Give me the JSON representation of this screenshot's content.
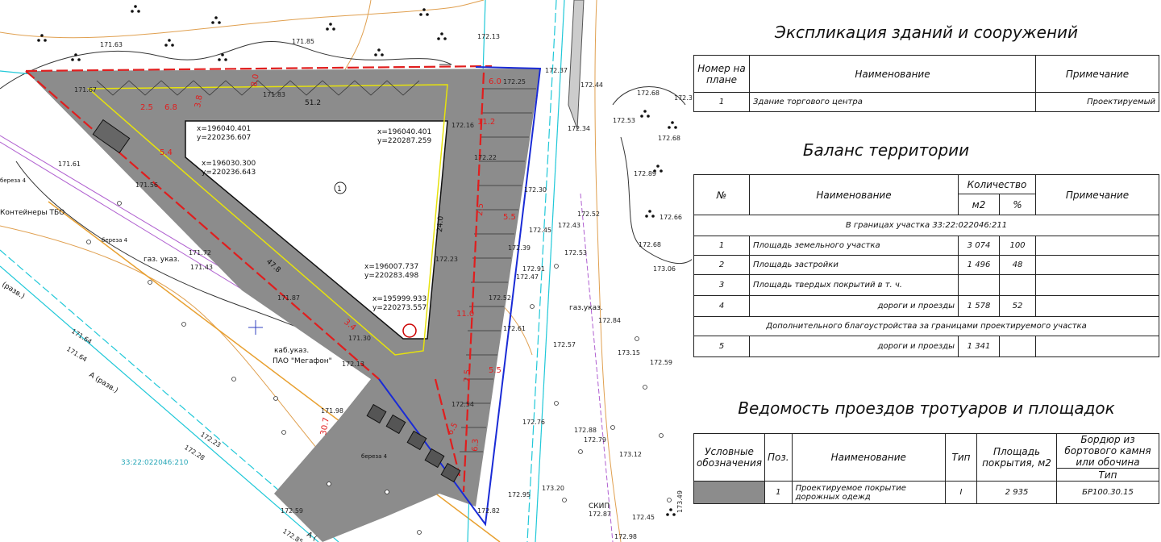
{
  "plan": {
    "labels": {
      "building_no": "1",
      "container": "Контейнеры ТБО",
      "megafon": "ПАО \"Мегафон\"",
      "kab": "каб.указ.",
      "gaz1": "газ. указ.",
      "gaz2": "газ.указ.",
      "skip": "СКИП",
      "parcel": "33:22:022046:210",
      "road1": "А (разв.)",
      "road2": "(разв.)",
      "road3": "А (",
      "bereza1": "береза 4",
      "bereza2": "береза 4",
      "bereza3": "береза 4"
    },
    "coords": [
      {
        "x": "x=196040.401",
        "y": "y=220236.607"
      },
      {
        "x": "x=196040.401",
        "y": "y=220287.259"
      },
      {
        "x": "x=196030.300",
        "y": "y=220236.643"
      },
      {
        "x": "x=196007.737",
        "y": "y=220283.498"
      },
      {
        "x": "x=195999.933",
        "y": "y=220273.557"
      }
    ],
    "dims": [
      "51.2",
      "47.8",
      "24.0",
      "11.2",
      "11.0",
      "30.7",
      "6.0",
      "5.5",
      "5.5",
      "2.5",
      "2.5",
      "6.5",
      "6.3",
      "3.8",
      "8.0",
      "2.5",
      "6.8",
      "5.4",
      "3.4"
    ],
    "elevations": [
      "171.63",
      "171.85",
      "171.67",
      "171.83",
      "171.61",
      "171.56",
      "171.72",
      "171.43",
      "171.87",
      "171.64",
      "171.64",
      "171.30",
      "172.13",
      "171.98",
      "172.23",
      "172.28",
      "172.59",
      "172.85",
      "172.13",
      "172.37",
      "172.25",
      "172.16",
      "172.22",
      "172.30",
      "172.39",
      "172.23",
      "172.45",
      "172.43",
      "172.47",
      "172.52",
      "172.61",
      "172.54",
      "172.91",
      "172.52",
      "172.53",
      "172.57",
      "172.44",
      "172.34",
      "172.68",
      "172.53",
      "172.68",
      "172.89",
      "172.66",
      "172.68",
      "173.06",
      "172.84",
      "173.15",
      "172.59",
      "172.76",
      "172.88",
      "172.79",
      "173.12",
      "172.95",
      "173.20",
      "172.82",
      "172.87",
      "172.98",
      "172.45",
      "173.49",
      "172.3"
    ]
  },
  "explication": {
    "title": "Экспликация зданий и сооружений",
    "headers": [
      "Номер на плане",
      "Наименование",
      "Примечание"
    ],
    "rows": [
      {
        "no": "1",
        "name": "Здание торгового центра",
        "note": "Проектируемый"
      }
    ]
  },
  "balance": {
    "title": "Баланс территории",
    "h_no": "№",
    "h_name": "Наименование",
    "h_qty": "Количество",
    "h_m2": "м2",
    "h_pct": "%",
    "h_note": "Примечание",
    "section1": "В границах участка 33:22:022046:211",
    "rows": [
      {
        "no": "1",
        "name": "Площадь земельного участка",
        "m2": "3 074",
        "pct": "100",
        "note": ""
      },
      {
        "no": "2",
        "name": "Площадь застройки",
        "m2": "1 496",
        "pct": "48",
        "note": ""
      },
      {
        "no": "3",
        "name": "Площадь твердых покрытий в т. ч.",
        "m2": "",
        "pct": "",
        "note": ""
      },
      {
        "no": "4",
        "name": "дороги и проезды",
        "m2": "1 578",
        "pct": "52",
        "note": ""
      }
    ],
    "section2": "Дополнительного благоустройства за границами проектируемого участка",
    "row5": {
      "no": "5",
      "name": "дороги и проезды",
      "m2": "1 341",
      "pct": "",
      "note": ""
    }
  },
  "roads": {
    "title": "Ведомость проездов тротуаров и площадок",
    "headers": [
      "Условные обозначения",
      "Поз.",
      "Наименование",
      "Тип",
      "Площадь покрытия, м2",
      "Бордюр из бортового камня или обочина"
    ],
    "sub_type": "Тип",
    "rows": [
      {
        "pos": "1",
        "name": "Проектируемое покрытие дорожных одежд",
        "type": "I",
        "area": "2 935",
        "curb": "БР100.30.15"
      }
    ]
  },
  "colors": {
    "pavement": "#8c8c8c",
    "red": "#e01e1e",
    "blue": "#1a2bd6",
    "cyan": "#20c8d8",
    "yellow": "#e6e20c",
    "orange": "#e0902a",
    "magenta": "#b060d0"
  }
}
